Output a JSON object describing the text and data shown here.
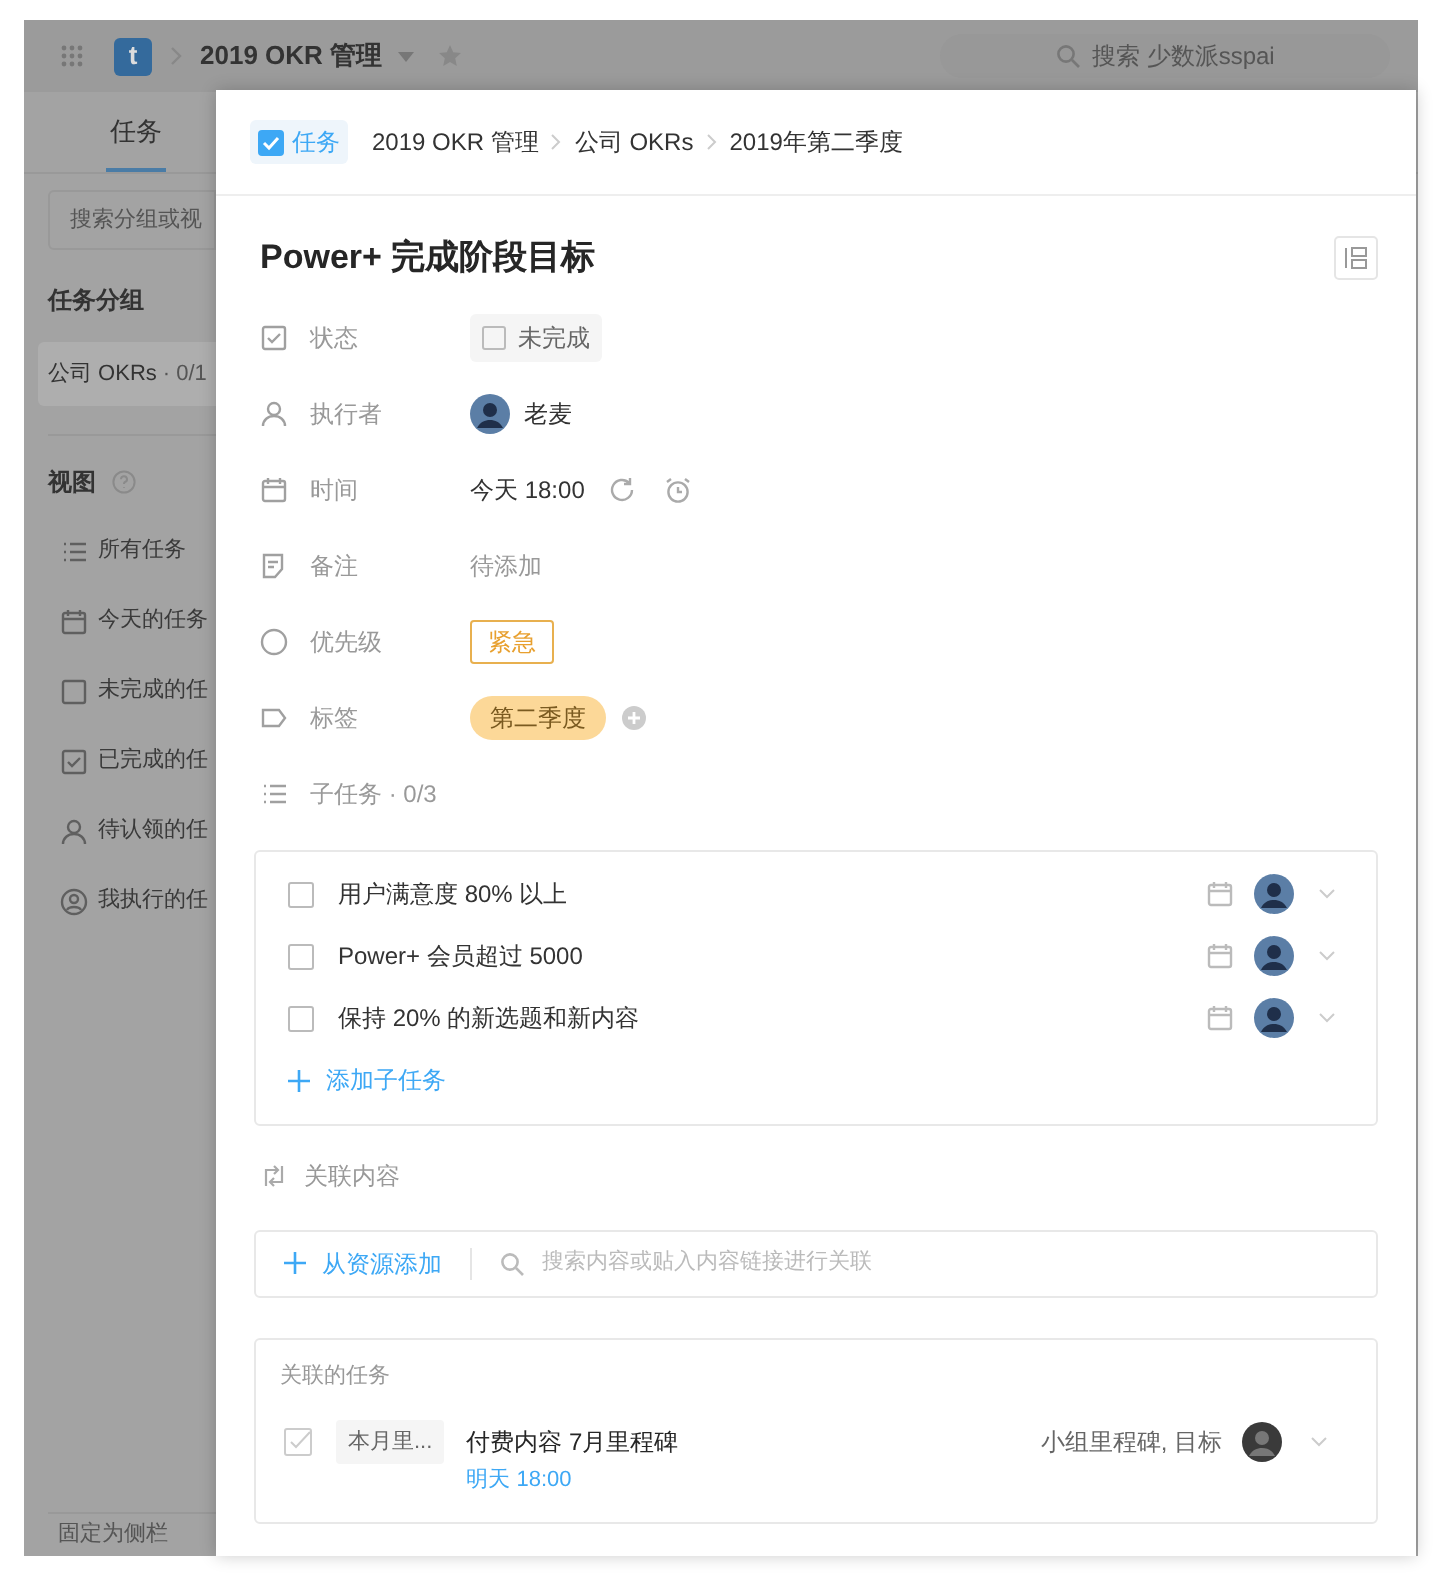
{
  "app_bar": {
    "logo_letter": "t",
    "project": "2019 OKR 管理",
    "search_placeholder": "搜索 少数派sspai"
  },
  "background_tabs": [
    {
      "label": "任务",
      "selected": true
    }
  ],
  "sidebar": {
    "search_placeholder": "搜索分组或视",
    "groups_title": "任务分组",
    "groups": [
      {
        "label": "公司 OKRs",
        "count": "· 0/1"
      }
    ],
    "views_title": "视图",
    "views": [
      {
        "kind": "list",
        "label": "所有任务"
      },
      {
        "kind": "calendar",
        "label": "今天的任务"
      },
      {
        "kind": "box",
        "label": "未完成的任"
      },
      {
        "kind": "check",
        "label": "已完成的任"
      },
      {
        "kind": "person",
        "label": "待认领的任"
      },
      {
        "kind": "me",
        "label": "我执行的任"
      }
    ],
    "footer": "固定为侧栏"
  },
  "task": {
    "type_label": "任务",
    "breadcrumb": [
      "2019 OKR 管理",
      "公司 OKRs",
      "2019年第二季度"
    ],
    "title": "Power+ 完成阶段目标",
    "fields": [
      {
        "kind": "status",
        "label": "状态",
        "value": "未完成",
        "done": false
      },
      {
        "kind": "assignee",
        "label": "执行者",
        "value": "老麦"
      },
      {
        "kind": "time",
        "label": "时间",
        "value": "今天 18:00"
      },
      {
        "kind": "note",
        "label": "备注",
        "placeholder": "待添加"
      },
      {
        "kind": "priority",
        "label": "优先级",
        "value": "紧急"
      },
      {
        "kind": "tags",
        "label": "标签",
        "tags": [
          "第二季度"
        ]
      }
    ],
    "subtasks": {
      "label": "子任务 · 0/3",
      "items": [
        {
          "title": "用户满意度 80% 以上",
          "checked": false
        },
        {
          "title": "Power+ 会员超过 5000",
          "checked": false
        },
        {
          "title": "保持 20% 的新选题和新内容",
          "checked": false
        }
      ],
      "add_label": "添加子任务"
    },
    "related": {
      "label": "关联内容",
      "add_label": "从资源添加",
      "search_placeholder": "搜索内容或贴入内容链接进行关联"
    },
    "linked_tasks": {
      "title": "关联的任务",
      "items": [
        {
          "stage": "本月里...",
          "title": "付费内容 7月里程碑",
          "due": "明天 18:00",
          "tags": "小组里程碑, 目标"
        }
      ]
    }
  }
}
